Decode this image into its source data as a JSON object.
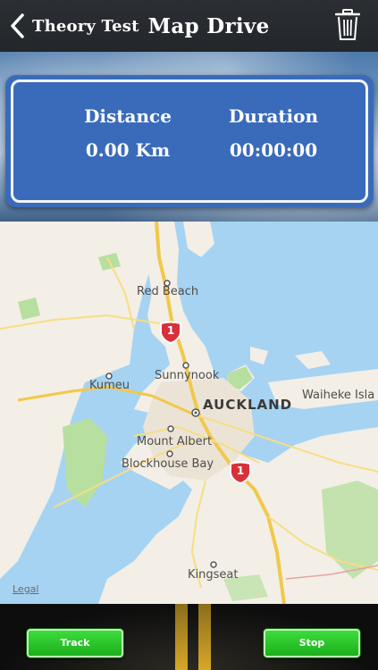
{
  "header": {
    "back_label": "Theory Test",
    "title": "Map Drive"
  },
  "stats": {
    "distance_label": "Distance",
    "distance_value": "0.00 Km",
    "duration_label": "Duration",
    "duration_value": "00:00:00"
  },
  "map": {
    "places": {
      "red_beach": "Red Beach",
      "sunnynook": "Sunnynook",
      "kumeu": "Kumeu",
      "auckland": "AUCKLAND",
      "waiheke": "Waiheke Isla",
      "mount_albert": "Mount Albert",
      "blockhouse_bay": "Blockhouse Bay",
      "kingseat": "Kingseat"
    },
    "pin_label": "1",
    "legal": "Legal"
  },
  "buttons": {
    "track": "Track",
    "stop": "Stop"
  },
  "colors": {
    "header_bg": "#23272b",
    "panel_bg": "#3a6bbb",
    "button_green": "#2cc42c",
    "map_water": "#a6d3f2",
    "map_land": "#f3efe6"
  },
  "icons": {
    "back": "chevron-left-icon",
    "trash": "trash-icon",
    "pin": "highway-shield-icon"
  }
}
